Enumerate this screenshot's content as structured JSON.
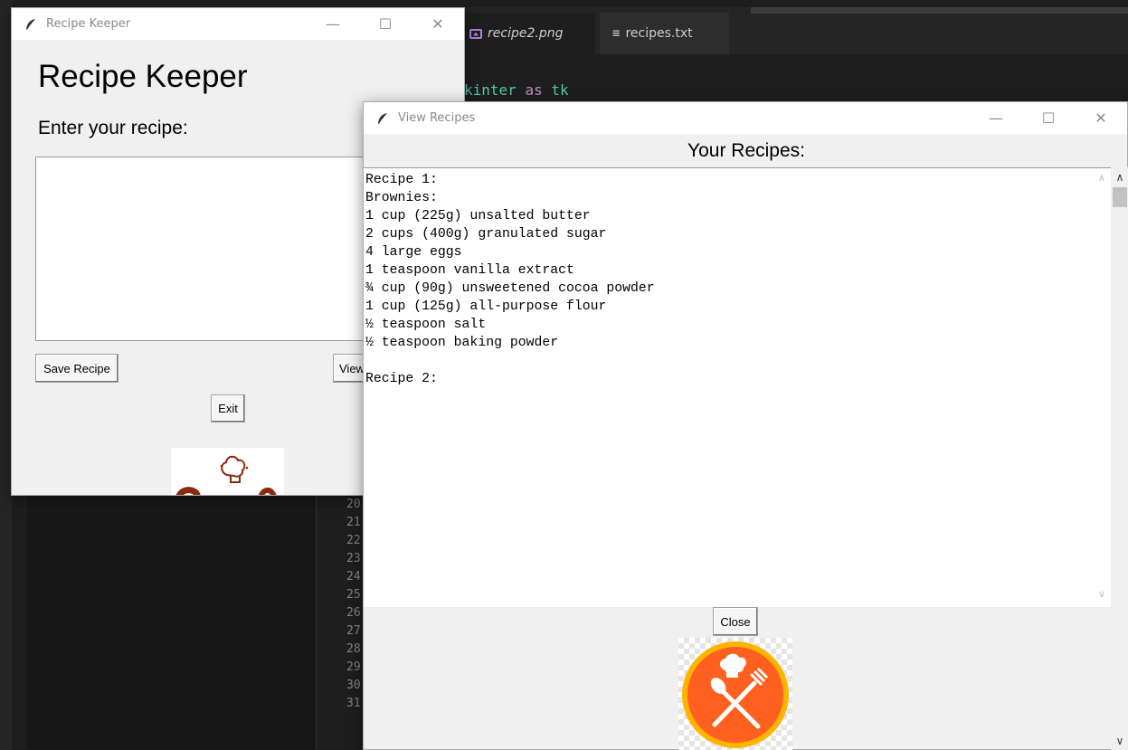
{
  "editor": {
    "tabs": [
      {
        "label": "recipe2.png",
        "icon": "image-file-icon"
      },
      {
        "label": "recipes.txt",
        "icon": "text-file-icon"
      }
    ],
    "code_fragment": {
      "text": "kinter",
      "keyword": "as",
      "alias": "tk"
    },
    "line_numbers": [
      "20",
      "21",
      "22",
      "23",
      "24",
      "25",
      "26",
      "27",
      "28",
      "29",
      "30",
      "31"
    ]
  },
  "keeper_window": {
    "title": "Recipe Keeper",
    "heading": "Recipe Keeper",
    "prompt": "Enter your recipe:",
    "input_value": "",
    "save_label": "Save Recipe",
    "view_label": "View",
    "exit_label": "Exit"
  },
  "view_window": {
    "title": "View Recipes",
    "heading": "Your Recipes:",
    "recipes_text": "Recipe 1:\nBrownies:\n1 cup (225g) unsalted butter\n2 cups (400g) granulated sugar\n4 large eggs\n1 teaspoon vanilla extract\n¾ cup (90g) unsweetened cocoa powder\n1 cup (125g) all-purpose flour\n½ teaspoon salt\n½ teaspoon baking powder\n\nRecipe 2:",
    "close_label": "Close"
  },
  "window_controls": {
    "minimize": "—",
    "maximize": "☐",
    "close": "✕"
  },
  "colors": {
    "logo_orange": "#ff5f1f",
    "logo_ring": "#ffb400",
    "brand_brown": "#8b2a0e"
  }
}
